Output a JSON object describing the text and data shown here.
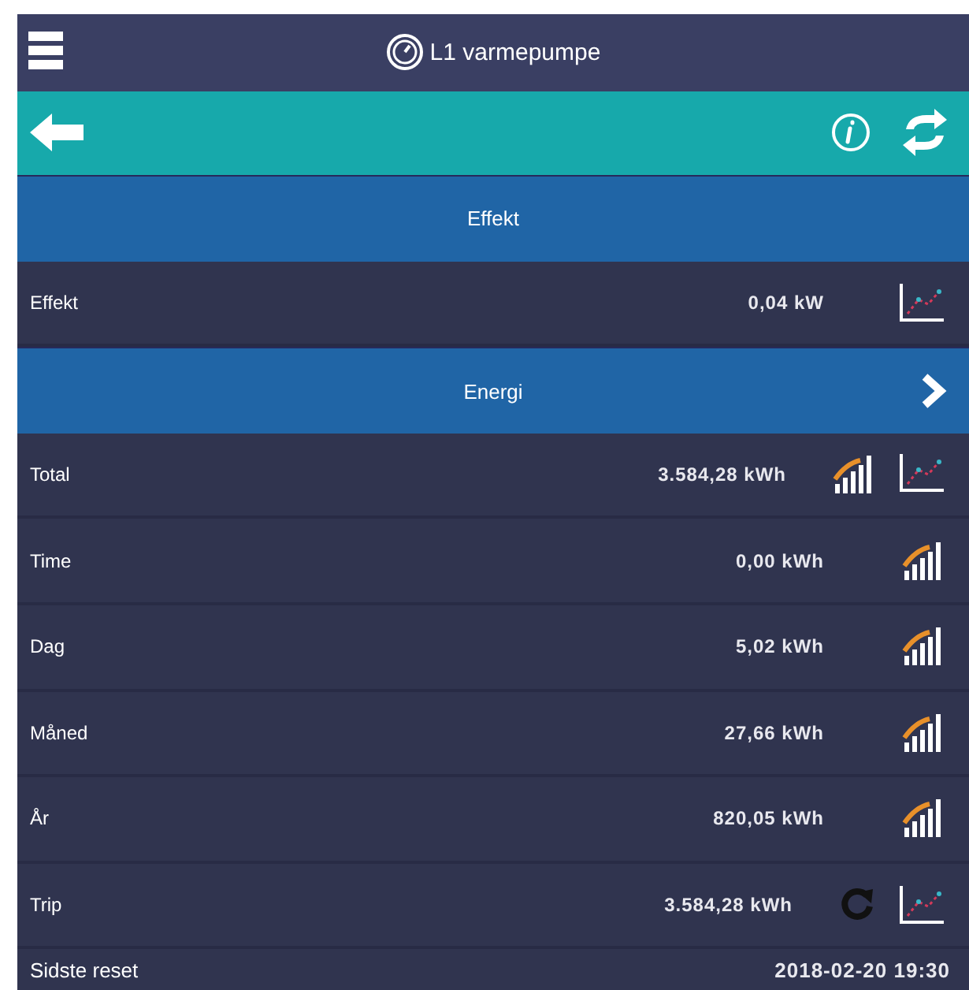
{
  "header": {
    "title": "L1 varmepumpe"
  },
  "sections": [
    {
      "title": "Effekt",
      "has_arrow": false,
      "rows": [
        {
          "label": "Effekt",
          "value": "0,04 kW",
          "icons": [
            {
              "kind": "chart"
            }
          ]
        }
      ]
    },
    {
      "title": "Energi",
      "has_arrow": true,
      "rows": [
        {
          "label": "Total",
          "value": "3.584,28 kWh",
          "icons": [
            {
              "kind": "bars"
            },
            {
              "kind": "chart"
            }
          ]
        },
        {
          "label": "Time",
          "value": "0,00 kWh",
          "icons": [
            {
              "kind": "bars"
            }
          ]
        },
        {
          "label": "Dag",
          "value": "5,02 kWh",
          "icons": [
            {
              "kind": "bars"
            }
          ]
        },
        {
          "label": "Måned",
          "value": "27,66 kWh",
          "icons": [
            {
              "kind": "bars"
            }
          ]
        },
        {
          "label": "År",
          "value": "820,05 kWh",
          "icons": [
            {
              "kind": "bars"
            }
          ]
        },
        {
          "label": "Trip",
          "value": "3.584,28 kWh",
          "icons": [
            {
              "kind": "reset"
            },
            {
              "kind": "chart"
            }
          ]
        }
      ]
    }
  ],
  "footer": {
    "label": "Sidste reset",
    "value": "2018-02-20 19:30"
  }
}
